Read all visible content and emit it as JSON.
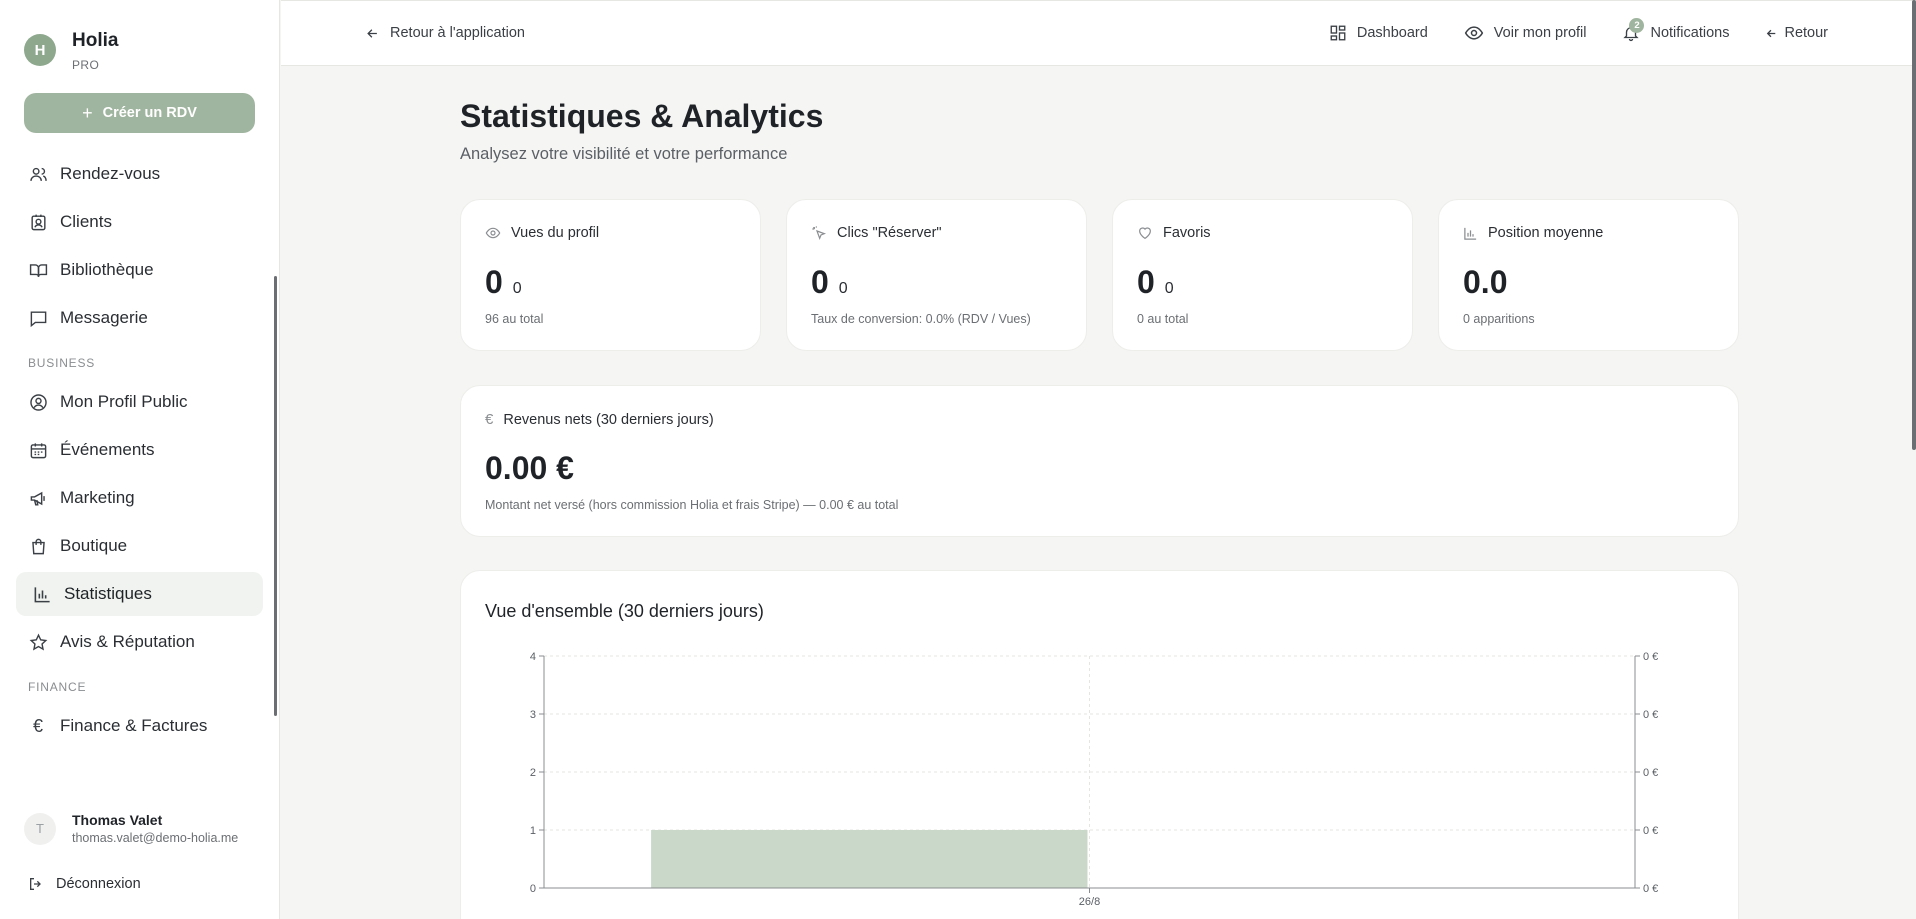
{
  "brand": {
    "initial": "H",
    "name": "Holia",
    "tier": "PRO"
  },
  "sidebar": {
    "create_label": "Créer un RDV",
    "items_top": [
      {
        "label": "Rendez-vous",
        "icon": "users-icon"
      },
      {
        "label": "Clients",
        "icon": "contact-icon"
      },
      {
        "label": "Bibliothèque",
        "icon": "book-icon"
      },
      {
        "label": "Messagerie",
        "icon": "message-icon"
      }
    ],
    "section_business": "BUSINESS",
    "items_business": [
      {
        "label": "Mon Profil Public",
        "icon": "user-circle-icon"
      },
      {
        "label": "Événements",
        "icon": "calendar-icon"
      },
      {
        "label": "Marketing",
        "icon": "megaphone-icon"
      },
      {
        "label": "Boutique",
        "icon": "shopping-bag-icon"
      },
      {
        "label": "Statistiques",
        "icon": "bar-chart-icon",
        "active": true
      },
      {
        "label": "Avis & Réputation",
        "icon": "star-icon"
      }
    ],
    "section_finance": "FINANCE",
    "items_finance": [
      {
        "label": "Finance & Factures",
        "icon": "euro-icon"
      }
    ],
    "user": {
      "initial": "T",
      "name": "Thomas Valet",
      "email": "thomas.valet@demo-holia.me"
    },
    "logout_label": "Déconnexion"
  },
  "topbar": {
    "back_label": "Retour à l'application",
    "dashboard_label": "Dashboard",
    "profile_label": "Voir mon profil",
    "notifications_label": "Notifications",
    "notifications_count": "2",
    "retour_label": "Retour"
  },
  "page": {
    "title": "Statistiques & Analytics",
    "subtitle": "Analysez votre visibilité et votre performance"
  },
  "stats": {
    "views": {
      "label": "Vues du profil",
      "value": "0",
      "delta": "0",
      "foot": "96 au total"
    },
    "clicks": {
      "label": "Clics \"Réserver\"",
      "value": "0",
      "delta": "0",
      "foot": "Taux de conversion: 0.0% (RDV / Vues)"
    },
    "favorites": {
      "label": "Favoris",
      "value": "0",
      "delta": "0",
      "foot": "0 au total"
    },
    "position": {
      "label": "Position moyenne",
      "value": "0.0",
      "foot": "0 apparitions"
    }
  },
  "revenue": {
    "label": "Revenus nets (30 derniers jours)",
    "value": "0.00 €",
    "foot": "Montant net versé (hors commission Holia et frais Stripe) — 0.00 € au total"
  },
  "chart_data": {
    "type": "bar",
    "title": "Vue d'ensemble (30 derniers jours)",
    "categories": [
      "26/8"
    ],
    "series": [
      {
        "values": [
          1
        ],
        "color": "#c9d8c8"
      }
    ],
    "ylim": [
      0,
      4
    ],
    "y_ticks": [
      "0",
      "1",
      "2",
      "3",
      "4"
    ],
    "y2_ticks": [
      "0 €",
      "0 €",
      "0 €",
      "0 €",
      "0 €"
    ],
    "grid": true
  }
}
